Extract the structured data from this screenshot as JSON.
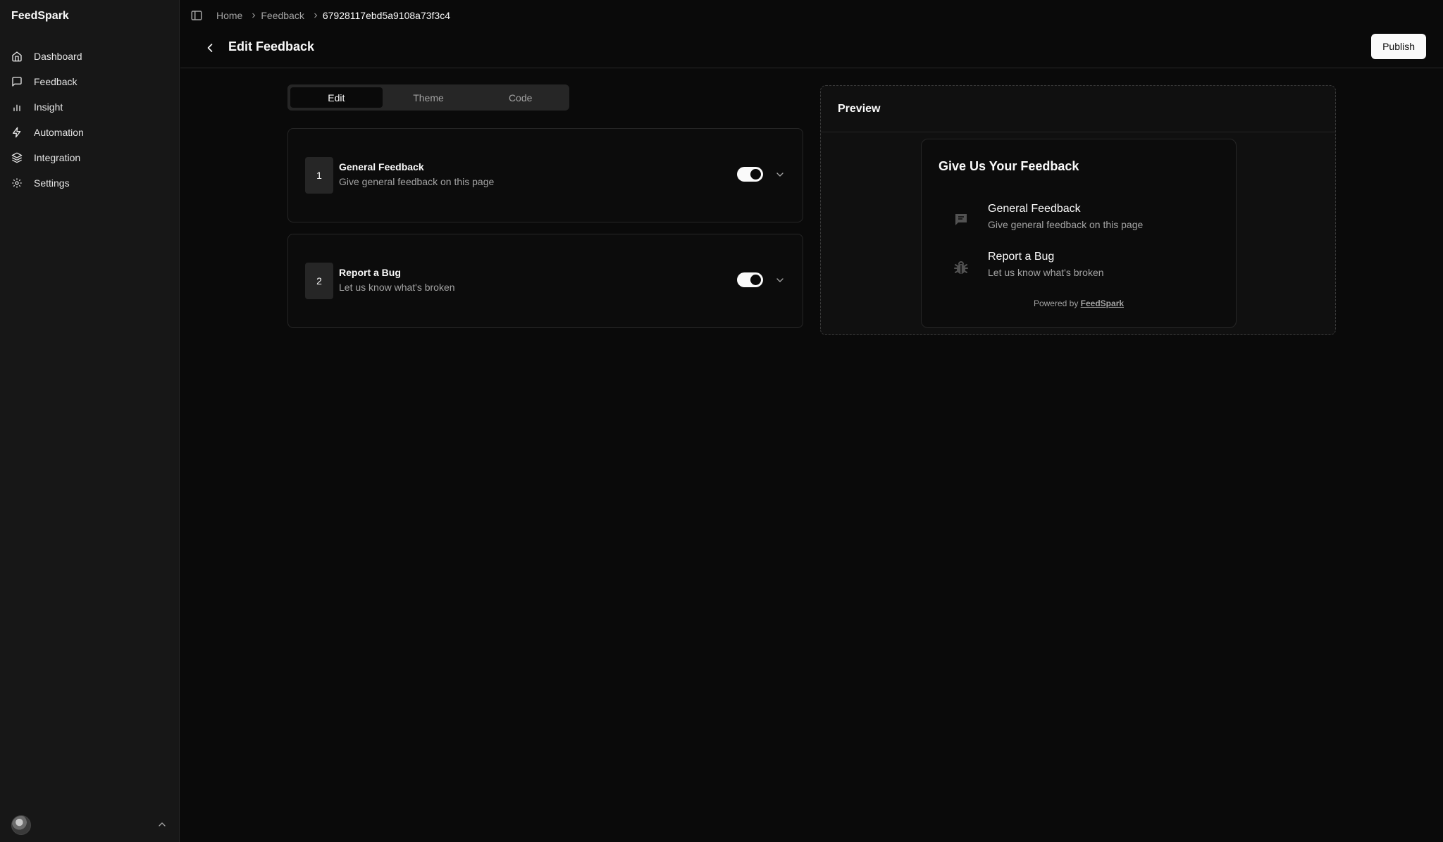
{
  "app": {
    "brand": "FeedSpark"
  },
  "sidebar": {
    "items": [
      {
        "label": "Dashboard",
        "icon": "home-icon"
      },
      {
        "label": "Feedback",
        "icon": "message-square-icon"
      },
      {
        "label": "Insight",
        "icon": "bar-chart-icon"
      },
      {
        "label": "Automation",
        "icon": "zap-icon"
      },
      {
        "label": "Integration",
        "icon": "layers-icon"
      },
      {
        "label": "Settings",
        "icon": "gear-icon"
      }
    ]
  },
  "breadcrumb": {
    "items": [
      "Home",
      "Feedback"
    ],
    "current": "67928117ebd5a9108a73f3c4"
  },
  "header": {
    "title": "Edit Feedback",
    "publish_label": "Publish"
  },
  "tabs": [
    {
      "label": "Edit",
      "active": true
    },
    {
      "label": "Theme",
      "active": false
    },
    {
      "label": "Code",
      "active": false
    }
  ],
  "options": [
    {
      "number": "1",
      "title": "General Feedback",
      "description": "Give general feedback on this page",
      "enabled": true
    },
    {
      "number": "2",
      "title": "Report a Bug",
      "description": "Let us know what's broken",
      "enabled": true
    }
  ],
  "preview": {
    "title": "Preview",
    "widget_title": "Give Us Your Feedback",
    "items": [
      {
        "title": "General Feedback",
        "description": "Give general feedback on this page",
        "icon": "chat-bubble-icon"
      },
      {
        "title": "Report a Bug",
        "description": "Let us know what's broken",
        "icon": "bug-icon"
      }
    ],
    "powered_by": "Powered by",
    "powered_brand": "FeedSpark"
  },
  "colors": {
    "background": "#0a0a0a",
    "sidebar": "#171717",
    "border": "#262626",
    "accent": "#fafafa",
    "muted": "#a3a3a3"
  }
}
